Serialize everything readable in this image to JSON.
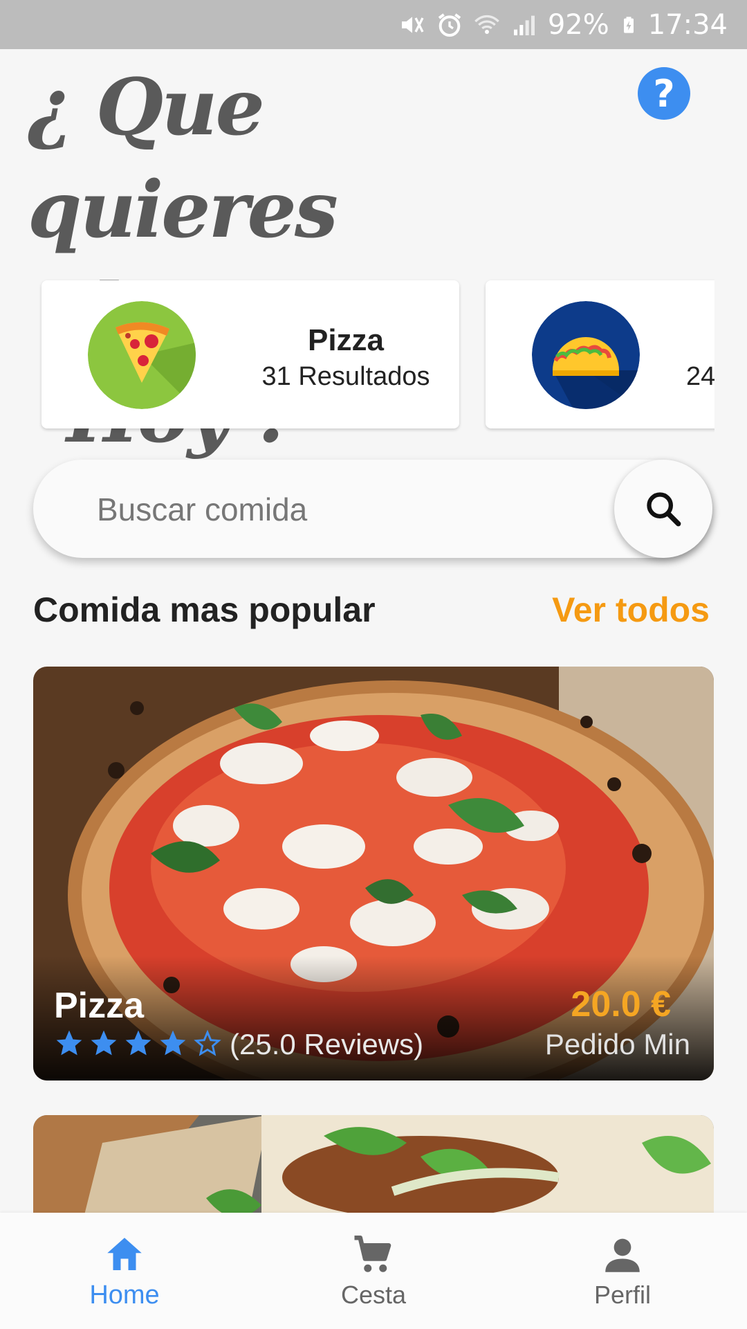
{
  "status_bar": {
    "battery": "92%",
    "time": "17:34",
    "icons": [
      "mute-icon",
      "alarm-icon",
      "wifi-icon",
      "signal-icon",
      "battery-charging-icon"
    ]
  },
  "header": {
    "title_line1": "¿ Que quieres",
    "title_line2": "de comer Hoy ?",
    "help_icon": "?"
  },
  "categories": [
    {
      "name": "Pizza",
      "count": "31 Resultados",
      "icon": "pizza-icon"
    },
    {
      "name": "",
      "count": "24",
      "icon": "taco-icon"
    }
  ],
  "search": {
    "placeholder": "Buscar comida"
  },
  "popular": {
    "title": "Comida mas popular",
    "see_all": "Ver todos",
    "items": [
      {
        "name": "Pizza",
        "rating": 4,
        "rating_max": 5,
        "reviews": "(25.0 Reviews)",
        "price": "20.0 €",
        "min_label": "Pedido Min"
      }
    ]
  },
  "nav": {
    "items": [
      {
        "label": "Home",
        "icon": "home-icon",
        "active": true
      },
      {
        "label": "Cesta",
        "icon": "cart-icon",
        "active": false
      },
      {
        "label": "Perfil",
        "icon": "person-icon",
        "active": false
      }
    ]
  },
  "colors": {
    "accent_blue": "#3d8ef0",
    "accent_orange": "#f59a12",
    "title_gray": "#5a5a5a"
  }
}
